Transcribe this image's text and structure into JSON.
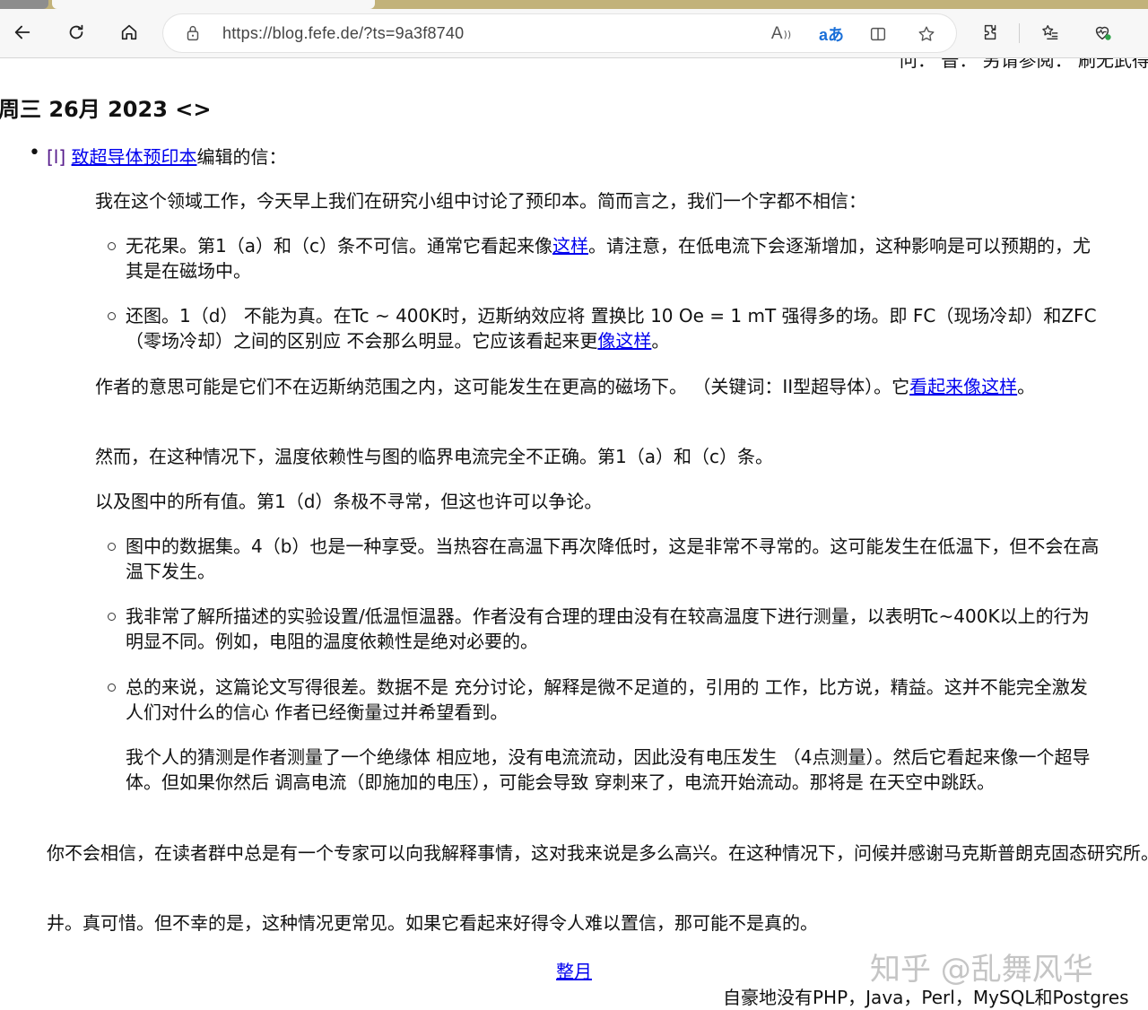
{
  "browser": {
    "url": "https://blog.fefe.de/?ts=9a3f8740",
    "read_aloud_label": "A",
    "translate_label": "aあ"
  },
  "page": {
    "top_partial": "问：  普：   另请参阅：  刷无武得",
    "date_heading": "周三 26月 2023",
    "nav_prev": "<",
    "nav_next": ">",
    "post": {
      "permalink": "[l]",
      "link_text": "致超导体预印本",
      "head_suffix": "编辑的信：",
      "intro": "我在这个领域工作，今天早上我们在研究小组中讨论了预印本。简而言之，我们一个字都不相信：",
      "list1": [
        {
          "before": "无花果。第1（a）和（c）条不可信。通常它看起来像",
          "link": "这样",
          "after": "。请注意，在低电流下会逐渐增加，这种影响是可以预期的，尤其是在磁场中。"
        },
        {
          "before": "还图。1（d） 不能为真。在Tc ~ 400K时，迈斯纳效应将 置换比 10 Oe = 1 mT 强得多的场。即 FC（现场冷却）和ZFC（零场冷却）之间的区别应 不会那么明显。它应该看起来更",
          "link": "像这样",
          "after": "。"
        }
      ],
      "para_a_before": "作者的意思可能是它们不在迈斯纳范围之内，这可能发生在更高的磁场下。 （关键词：II型超导体）。它",
      "para_a_link": "看起来像这样",
      "para_a_after": "。",
      "para_b": "然而，在这种情况下，温度依赖性与图的临界电流完全不正确。第1（a）和（c）条。",
      "para_c": "以及图中的所有值。第1（d）条极不寻常，但这也许可以争论。",
      "list2": [
        "图中的数据集。4（b）也是一种享受。当热容在高温下再次降低时，这是非常不寻常的。这可能发生在低温下，但不会在高温下发生。",
        "我非常了解所描述的实验设置/低温恒温器。作者没有合理的理由没有在较高温度下进行测量，以表明Tc~400K以上的行为明显不同。例如，电阻的温度依赖性是绝对必要的。",
        "总的来说，这篇论文写得很差。数据不是 充分讨论，解释是微不足道的，引用的 工作，比方说，精益。这并不能完全激发人们对什么的信心 作者已经衡量过并希望看到。"
      ],
      "list2_extra": "我个人的猜测是作者测量了一个绝缘体 相应地，没有电流流动，因此没有电压发生 （4点测量）。然后它看起来像一个超导体。但如果你然后 调高电流（即施加的电压），可能会导致 穿刺来了，电流开始流动。那将是 在天空中跳跃。",
      "outro_1": "你不会相信，在读者群中总是有一个专家可以向我解释事情，这对我来说是多么高兴。在这种情况下，问候并感谢马克斯普朗克固态研究所。",
      "outro_2": "井。真可惜。但不幸的是，这种情况更常见。如果它看起来好得令人难以置信，那可能不是真的。"
    },
    "footer_link": "整月",
    "footer_text": "自豪地没有PHP，Java，Perl，MySQL和Postgres",
    "watermark": "知乎 @乱舞风华"
  }
}
